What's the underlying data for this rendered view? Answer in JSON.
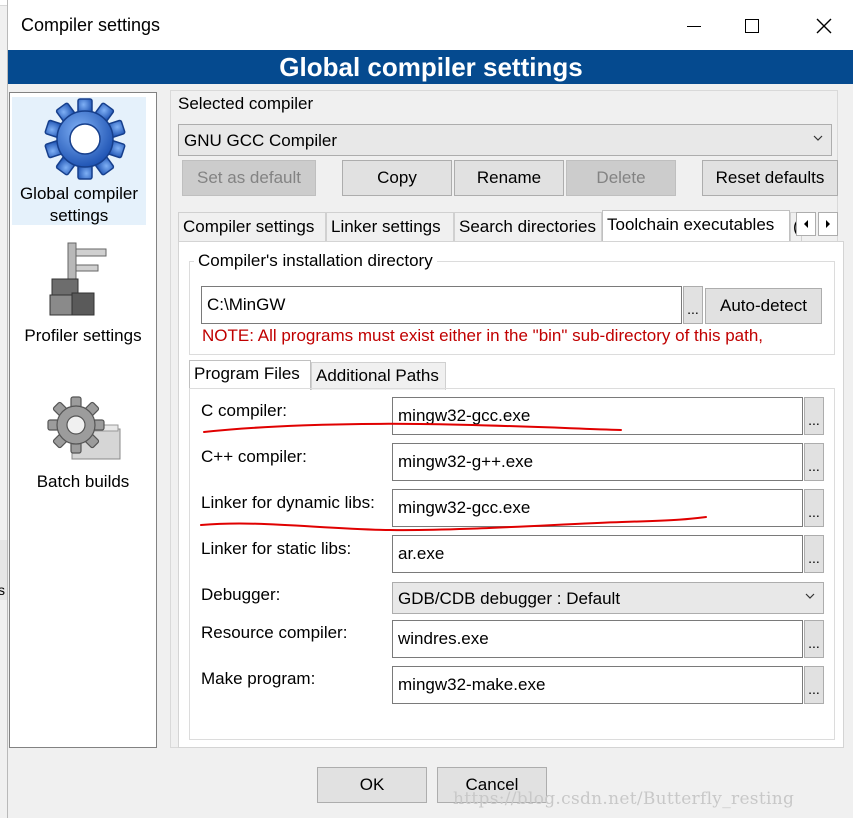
{
  "window": {
    "title": "Compiler settings",
    "banner": "Global compiler settings"
  },
  "sidebar": {
    "items": [
      {
        "label": "Global compiler settings",
        "line1": "Global compiler",
        "line2": "settings",
        "icon": "gear-icon",
        "selected": true
      },
      {
        "label": "Profiler settings",
        "icon": "caliper-icon"
      },
      {
        "label": "Batch builds",
        "icon": "gear-stack-icon"
      }
    ]
  },
  "selected_compiler": {
    "label": "Selected compiler",
    "value": "GNU GCC Compiler"
  },
  "buttons": {
    "set_default": "Set as default",
    "copy": "Copy",
    "rename": "Rename",
    "delete": "Delete",
    "reset": "Reset defaults"
  },
  "tabs": [
    {
      "label": "Compiler settings"
    },
    {
      "label": "Linker settings"
    },
    {
      "label": "Search directories"
    },
    {
      "label": "Toolchain executables",
      "active": true
    },
    {
      "label": "("
    }
  ],
  "install": {
    "title": "Compiler's installation directory",
    "value": "C:\\MinGW",
    "browse": "...",
    "autodetect": "Auto-detect",
    "note": "NOTE: All programs must exist either in the \"bin\" sub-directory of this path,"
  },
  "subtabs": [
    {
      "label": "Program Files",
      "active": true
    },
    {
      "label": "Additional Paths"
    }
  ],
  "programs": {
    "c_label": "C compiler:",
    "c_value": "mingw32-gcc.exe",
    "cpp_label": "C++ compiler:",
    "cpp_value": "mingw32-g++.exe",
    "dyn_label": "Linker for dynamic libs:",
    "dyn_value": "mingw32-gcc.exe",
    "static_label": "Linker for static libs:",
    "static_value": "ar.exe",
    "debugger_label": "Debugger:",
    "debugger_value": "GDB/CDB debugger : Default",
    "res_label": "Resource compiler:",
    "res_value": "windres.exe",
    "make_label": "Make program:",
    "make_value": "mingw32-make.exe",
    "browse": "..."
  },
  "dialog": {
    "ok": "OK",
    "cancel": "Cancel"
  },
  "watermark": "https://blog.csdn.net/Butterfly_resting",
  "colors": {
    "banner": "#054a8f",
    "note": "#c00000",
    "annotation": "#e00000"
  }
}
